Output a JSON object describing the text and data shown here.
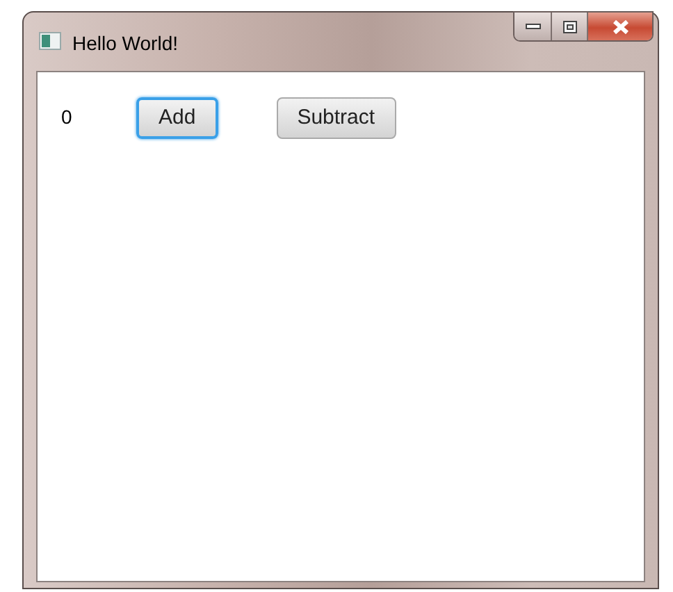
{
  "window": {
    "title": "Hello World!"
  },
  "counter": "0",
  "buttons": [
    {
      "label": "Add",
      "focused": true
    },
    {
      "label": "Subtract",
      "focused": false
    }
  ]
}
